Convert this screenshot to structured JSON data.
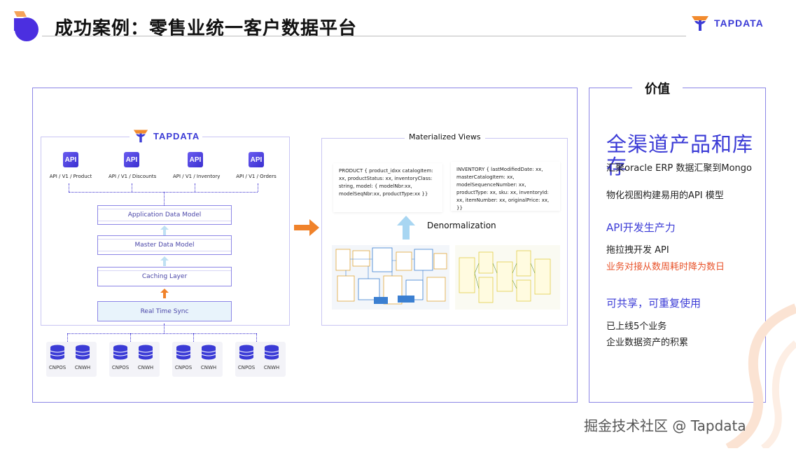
{
  "slide": {
    "title": "成功案例：零售业统一客户数据平台",
    "logo_text": "TAPDATA"
  },
  "architecture": {
    "logo_text": "TAPDATA",
    "apis": [
      {
        "chip": "API",
        "label": "API / V1 / Product"
      },
      {
        "chip": "API",
        "label": "API / V1 / Discounts"
      },
      {
        "chip": "API",
        "label": "API / V1 / Inventory"
      },
      {
        "chip": "API",
        "label": "API / V1 / Orders"
      }
    ],
    "layers": {
      "application": "Application Data Model",
      "master": "Master Data Model",
      "caching": "Caching Layer",
      "sync": "Real Time Sync"
    },
    "sources": [
      {
        "a": "CNPOS",
        "b": "CNWH"
      },
      {
        "a": "CNPOS",
        "b": "CNWH"
      },
      {
        "a": "CNPOS",
        "b": "CNWH"
      },
      {
        "a": "CNPOS",
        "b": "CNWH"
      }
    ]
  },
  "materialized": {
    "title": "Materialized Views",
    "product_code": "PRODUCT {   product_idxx   catalogItem: xx,   productStatus: xx,   inventoryClass: string,   model: {     modelNbr:xx, modelSeqNbr:xx,     productType:xx   }}",
    "inventory_code": "INVENTORY { lastModifiedDate: xx, masterCatalogItem: xx, modelSequenceNumber: xx,   productType: xx,   sku: xx,   inventoryId: xx, itemNumber: xx,   originalPrice: xx, }}",
    "denormalization": "Denormalization"
  },
  "value": {
    "heading": "价值",
    "big_title": "全渠道产品和库存",
    "line1": "汇聚oracle ERP 数据汇聚到Mongo",
    "line2": "物化视图构建易用的API 模型",
    "api_title": "API开发生产力",
    "api_line1": "拖拉拽开发 API",
    "api_line2": "业务对接从数周耗时降为数日",
    "share_title": "可共享，可重复使用",
    "share_line1": "已上线5个业务",
    "share_line2": "企业数据资产的积累"
  },
  "watermark": "掘金技术社区 @ Tapdata",
  "colors": {
    "accent": "#3b3bd6",
    "border": "#8c86e6",
    "orange": "#f0822a",
    "red": "#e8542c"
  }
}
